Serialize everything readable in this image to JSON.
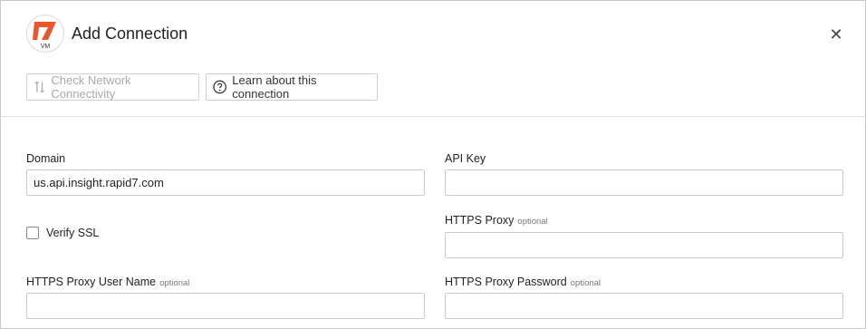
{
  "dialog": {
    "title": "Add Connection",
    "logo_sub": "VM",
    "brand_color": "#e8582a",
    "close_label": "✕"
  },
  "toolbar": {
    "check_label": "Check Network Connectivity",
    "learn_label": "Learn about this connection"
  },
  "form": {
    "domain": {
      "label": "Domain",
      "value": "us.api.insight.rapid7.com"
    },
    "api_key": {
      "label": "API Key",
      "value": ""
    },
    "verify_ssl": {
      "label": "Verify SSL",
      "checked": false
    },
    "https_proxy": {
      "label": "HTTPS Proxy",
      "optional": "optional",
      "value": ""
    },
    "proxy_user": {
      "label": "HTTPS Proxy User Name",
      "optional": "optional",
      "value": ""
    },
    "proxy_password": {
      "label": "HTTPS Proxy Password",
      "optional": "optional",
      "value": ""
    }
  },
  "icons": {
    "check": "network-check-icon",
    "learn": "help-circle-icon",
    "close": "close-icon"
  }
}
